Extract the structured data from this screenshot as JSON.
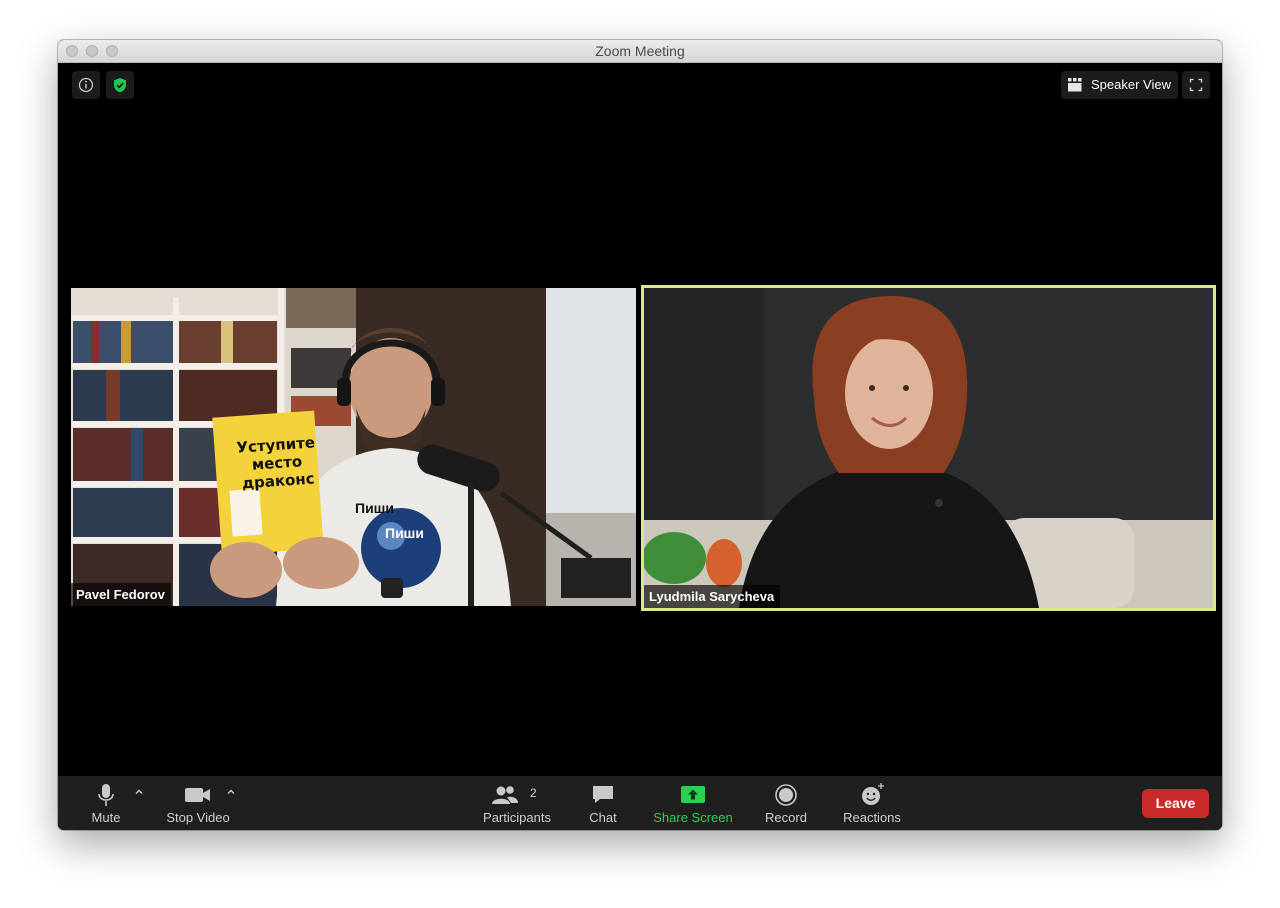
{
  "window": {
    "title": "Zoom Meeting"
  },
  "top_bar": {
    "speaker_view_label": "Speaker View"
  },
  "participants_video": [
    {
      "name": "Pavel Fedorov"
    },
    {
      "name": "Lyudmila Sarycheva"
    }
  ],
  "book": {
    "title_line1": "Уступите",
    "title_line2": "место",
    "title_line3": "драконс"
  },
  "shirt": {
    "text1": "Пиши",
    "text2": "Пиши"
  },
  "toolbar": {
    "mute_label": "Mute",
    "stop_video_label": "Stop Video",
    "participants_label": "Participants",
    "participants_count": "2",
    "chat_label": "Chat",
    "share_screen_label": "Share Screen",
    "record_label": "Record",
    "reactions_label": "Reactions",
    "leave_label": "Leave"
  },
  "colors": {
    "active_speaker_border": "#d8e98a",
    "share_screen_green": "#2fd04d",
    "leave_red": "#c92a2a",
    "shield_green": "#23c552"
  }
}
